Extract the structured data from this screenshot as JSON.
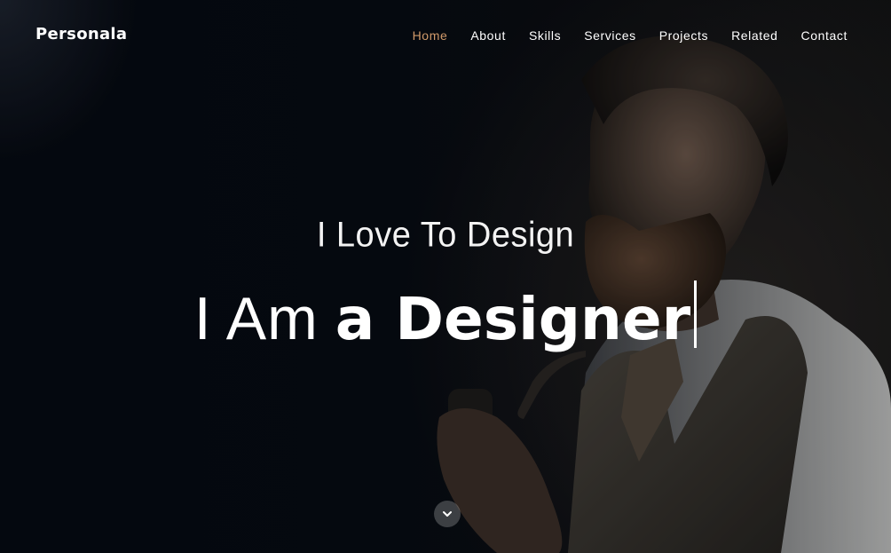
{
  "brand": {
    "logo": "Personala"
  },
  "nav": {
    "items": [
      {
        "label": "Home",
        "active": true
      },
      {
        "label": "About",
        "active": false
      },
      {
        "label": "Skills",
        "active": false
      },
      {
        "label": "Services",
        "active": false
      },
      {
        "label": "Projects",
        "active": false
      },
      {
        "label": "Related",
        "active": false
      },
      {
        "label": "Contact",
        "active": false
      }
    ]
  },
  "hero": {
    "tagline": "I Love To Design",
    "headline_prefix": "I Am",
    "headline_role": "a Designer",
    "scroll_icon": "chevron-down-icon"
  },
  "colors": {
    "background": "#05070c",
    "active_nav": "#d19a6a",
    "text": "#ffffff"
  }
}
